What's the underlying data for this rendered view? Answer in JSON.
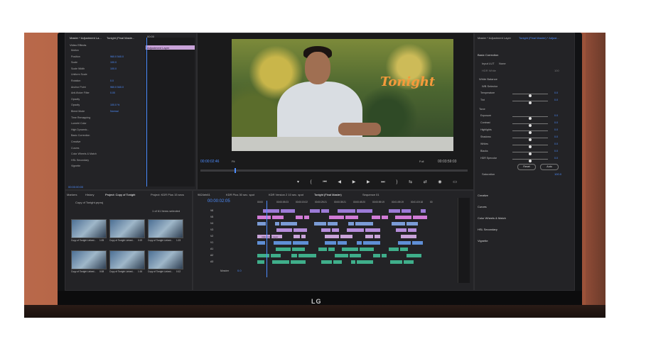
{
  "effect_controls": {
    "source_label": "Master * Adjustment La...",
    "sequence_label": "Tonight (Final Maste...",
    "clip_timecode": "00:00",
    "clip_name": "Adjustment Layer",
    "video_effects_label": "Video Effects",
    "rows": [
      {
        "label": "Motion",
        "value": ""
      },
      {
        "label": "Position",
        "value": "960.0   540.0"
      },
      {
        "label": "Scale",
        "value": "100.0"
      },
      {
        "label": "Scale Width",
        "value": "100.0"
      },
      {
        "label": "Uniform Scale",
        "value": ""
      },
      {
        "label": "Rotation",
        "value": "0.0"
      },
      {
        "label": "Anchor Point",
        "value": "960.0   540.0"
      },
      {
        "label": "Anti-flicker Filter",
        "value": "0.00"
      },
      {
        "label": "Opacity",
        "value": ""
      },
      {
        "label": "Opacity",
        "value": "100.0 %"
      },
      {
        "label": "Blend Mode",
        "value": "Normal"
      },
      {
        "label": "Time Remapping",
        "value": ""
      },
      {
        "label": "Lumetri Color",
        "value": ""
      },
      {
        "label": "High Dynamic...",
        "value": ""
      },
      {
        "label": "Basic Correction",
        "value": ""
      },
      {
        "label": "Creative",
        "value": ""
      },
      {
        "label": "Curves",
        "value": ""
      },
      {
        "label": "Color Wheels & Match",
        "value": ""
      },
      {
        "label": "HSL Secondary",
        "value": ""
      },
      {
        "label": "Vignette",
        "value": ""
      }
    ],
    "bottom_timecode": "00:00:00:00"
  },
  "program_monitor": {
    "overlay_title": "Tonight",
    "timecode_left": "00:00:02:46",
    "fit_label": "Fit",
    "quality_label": "Full",
    "timecode_right": "00:03:59:03"
  },
  "lumetri": {
    "header_left": "Master * Adjustment Layer",
    "header_right": "Tonight (Final Master) * Adjust...",
    "basic_correction": "Basic Correction",
    "input_lut_label": "Input LUT",
    "input_lut_value": "None",
    "hdr_white_label": "HDR White",
    "hdr_white_value": "100",
    "white_balance": "White Balance",
    "wb_selector": "WB Selector",
    "tone": "Tone",
    "rows": [
      {
        "label": "Temperature",
        "value": "0.0",
        "knob": 0.5
      },
      {
        "label": "Tint",
        "value": "0.0",
        "knob": 0.5
      },
      {
        "label": "Exposure",
        "value": "0.0",
        "knob": 0.5
      },
      {
        "label": "Contrast",
        "value": "0.0",
        "knob": 0.5
      },
      {
        "label": "Highlights",
        "value": "0.0",
        "knob": 0.5
      },
      {
        "label": "Shadows",
        "value": "0.0",
        "knob": 0.5
      },
      {
        "label": "Whites",
        "value": "0.0",
        "knob": 0.5
      },
      {
        "label": "Blacks",
        "value": "0.0",
        "knob": 0.5
      },
      {
        "label": "HDR Specular",
        "value": "0.0",
        "knob": 0.5
      }
    ],
    "reset_label": "Reset",
    "auto_label": "Auto",
    "saturation_label": "Saturation",
    "saturation_value": "100.0",
    "sections": [
      "Creative",
      "Curves",
      "Color Wheels & Match",
      "HSL Secondary",
      "Vignette"
    ]
  },
  "project": {
    "tabs": [
      "Markers",
      "History",
      "Project: Copy of Tonight",
      "Project: KDR Plus 15 secs"
    ],
    "bin_name": "Copy of Tonight.prproj",
    "items_selected": "1 of 61 Items selected",
    "thumbs": [
      {
        "name": "Copy of Tonight Linked...",
        "duration": "1:05"
      },
      {
        "name": "Copy of Tonight Linked...",
        "duration": "0:19"
      },
      {
        "name": "Copy of Tonight Linked...",
        "duration": "1:23"
      },
      {
        "name": "Copy of Tonight Linked...",
        "duration": "0:08"
      },
      {
        "name": "Copy of Tonight Linked...",
        "duration": "1:16"
      },
      {
        "name": "Copy of Tonight Linked...",
        "duration": "0:12"
      }
    ]
  },
  "timeline": {
    "tabs": [
      "9824eb61",
      "KDR Plus 30 sec. spot",
      "KDR Version 2 10 sec. spot",
      "Tonight (Final Master)",
      "Sequence 01"
    ],
    "timecode": "00:00:02:05",
    "ruler": [
      "00:00",
      "00:00:09:23",
      "00:00:19:22",
      "00:00:29:21",
      "00:00:39:21",
      "00:00:49:20",
      "00:00:59:19",
      "00:01:09:19",
      "00:01:19:18",
      "00"
    ],
    "tracks": [
      "V6",
      "V5",
      "V4",
      "V3",
      "V2",
      "V1",
      "A1",
      "A2",
      "A3"
    ],
    "adjustment_layer_clip": "Adjustment Layer",
    "master_label": "Master",
    "master_value": "0.0"
  },
  "brand": "LG"
}
